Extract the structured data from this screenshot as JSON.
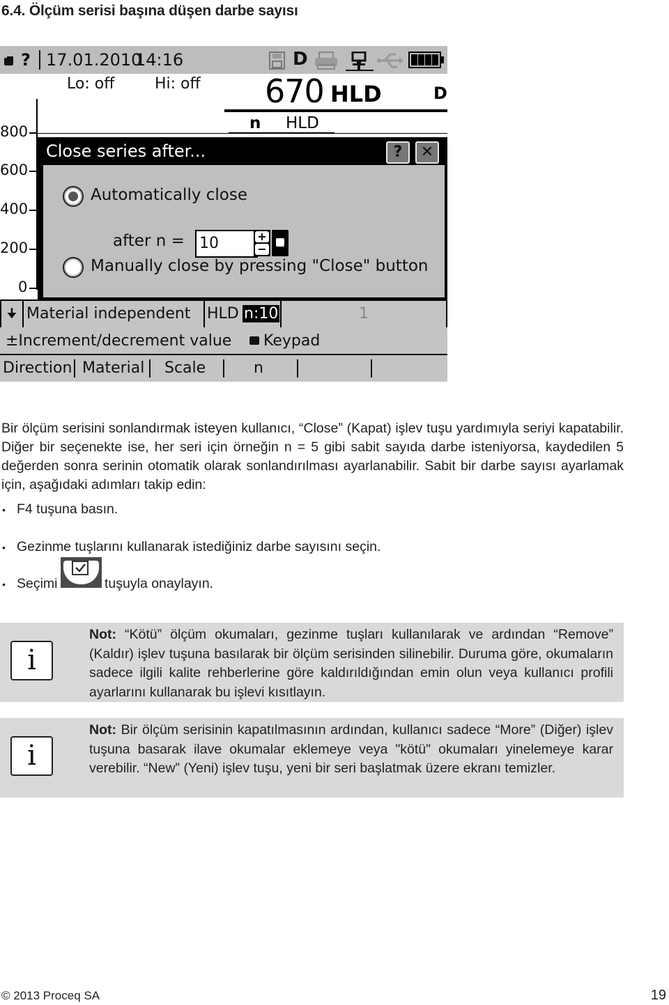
{
  "heading": "6.4. Ölçüm serisi başına düşen darbe sayısı",
  "device": {
    "statusbar": {
      "help_glyph": "?",
      "date": "17.01.2010",
      "time": "14:16",
      "icons": [
        "keypad-icon",
        "memory-card-icon",
        "probe-d-icon",
        "printer-icon",
        "network-icon",
        "usb-icon",
        "battery-icon"
      ],
      "probe_letter": "D",
      "battery_level": 1.0
    },
    "limits": {
      "lo": "Lo: off",
      "hi": "Hi: off"
    },
    "reading": {
      "value": "670",
      "unit": "HLD",
      "probe": "D"
    },
    "table_header": {
      "n": "n",
      "unit": "HLD"
    },
    "axis_ticks": [
      "800",
      "600",
      "400",
      "200",
      "0"
    ],
    "dialog": {
      "title": "Close series after...",
      "help_label": "?",
      "close_label": "✕",
      "option_auto": {
        "label": "Automatically close",
        "selected": true
      },
      "after_label": "after n =",
      "n_value": "10",
      "plus": "+",
      "minus": "−",
      "option_manual": {
        "label": "Manually close by pressing \"Close\" button",
        "selected": false
      }
    },
    "info_row": {
      "direction_glyph": "🠋",
      "material": "Material independent",
      "scale": "HLD",
      "n_setting": "n:10",
      "count": "1"
    },
    "hint_row": {
      "increment": "±Increment/decrement value",
      "keypad": "Keypad"
    },
    "softkeys": [
      "Direction",
      "Material",
      "Scale",
      "n",
      "",
      ""
    ]
  },
  "paragraph": "Bir ölçüm serisini sonlandırmak isteyen kullanıcı, “Close” (Kapat) işlev tuşu yardımıyla seriyi kapatabilir. Diğer bir seçenekte ise, her seri için örneğin n = 5 gibi sabit sayıda darbe isteniyorsa, kaydedilen 5 değerden sonra serinin otomatik olarak sonlandırılması ayarlanabilir. Sabit bir darbe sayısı ayarlamak için, aşağıdaki adımları takip edin:",
  "steps": [
    {
      "text": "F4 tuşuna basın."
    },
    {
      "text": "Gezinme tuşlarını kullanarak istediğiniz darbe sayısını seçin."
    },
    {
      "before": "Seçimi",
      "after": "tuşuyla onaylayın.",
      "key_icon": "confirm-key-icon"
    }
  ],
  "notes": [
    {
      "label": "Not:",
      "text": " “Kötü” ölçüm okumaları, gezinme tuşları kullanılarak ve ardından “Remove” (Kaldır) işlev tuşuna basılarak bir ölçüm serisinden silinebilir. Duruma göre, okumaların sadece ilgili kalite rehberlerine göre kaldırıldığından emin olun veya kullanıcı profili ayarlarını kullanarak bu işlevi kısıtlayın.",
      "icon": "i"
    },
    {
      "label": "Not:",
      "text": " Bir ölçüm serisinin kapatılmasının ardından, kullanıcı sadece “More” (Diğer) işlev tuşuna basarak ilave okumalar eklemeye veya \"kötü\" okumaları yinelemeye karar verebilir. “New” (Yeni) işlev tuşu, yeni bir seri başlatmak üzere ekranı temizler.",
      "icon": "i"
    }
  ],
  "footer": {
    "copyright": "© 2013 Proceq SA",
    "page": "19"
  }
}
